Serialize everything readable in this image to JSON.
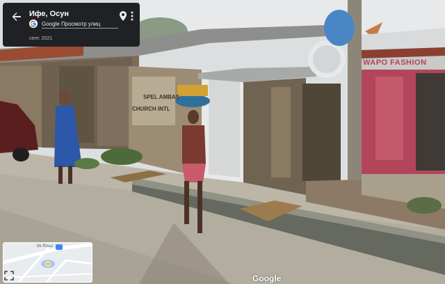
{
  "header": {
    "place_title": "Ифе, Осун",
    "source": "Google Просмотр улиц",
    "date": "сент. 2021"
  },
  "icons": {
    "back": "arrow-left-icon",
    "pin": "location-pin-icon",
    "more": "more-vert-icon",
    "expand": "fullscreen-icon",
    "google": "google-g-logo"
  },
  "scene": {
    "shop_sign": "WAPO FASHION",
    "wall_sign_1": "SPEL AMBAS",
    "wall_sign_2": "CHURCH INTL"
  },
  "minimap": {
    "road_label": "Ife Road"
  },
  "watermark": "Google",
  "colors": {
    "card_bg": "#202124",
    "sky": "#dcdfe0",
    "road": "#b9b3a6",
    "shop_wall": "#b3455a"
  }
}
